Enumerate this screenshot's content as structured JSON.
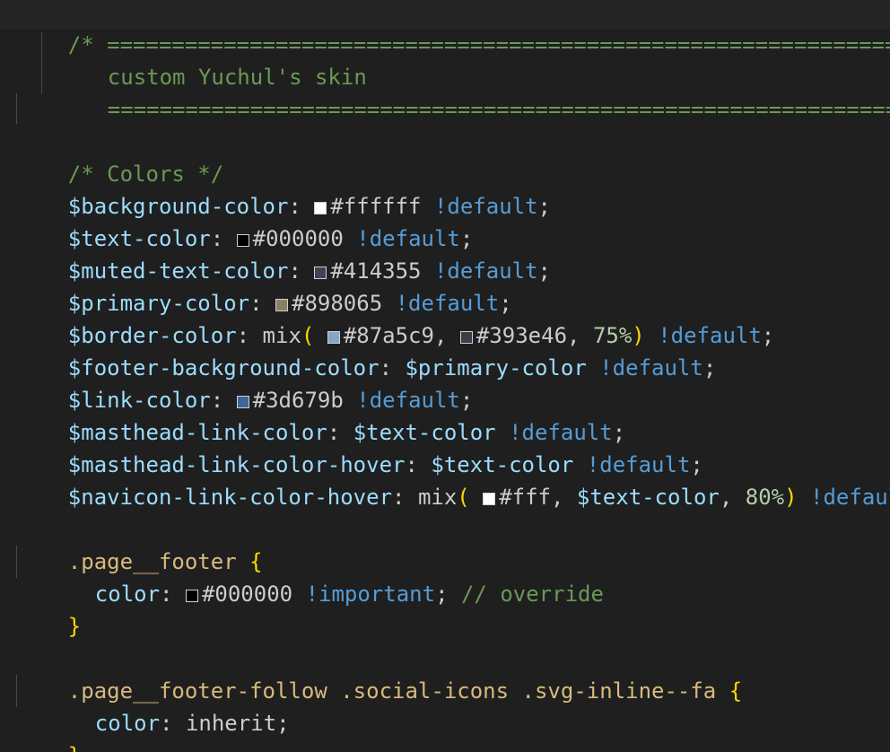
{
  "header_comment": {
    "open": "/* ",
    "rule": "================================================================",
    "title": "custom Yuchul's skin",
    "rule2": "================================================================"
  },
  "colors_comment": "/* Colors */",
  "default_kw": "!default",
  "important_kw": "!important",
  "swatch_colors": {
    "ffffff": "#ffffff",
    "000000": "#000000",
    "414355": "#414355",
    "898065": "#898065",
    "87a5c9": "#87a5c9",
    "393e46": "#393e46",
    "3d679b": "#3d679b",
    "fff": "#ffffff"
  },
  "vars": {
    "background": {
      "name": "$background-color",
      "value": "#ffffff"
    },
    "text": {
      "name": "$text-color",
      "value": "#000000"
    },
    "muted": {
      "name": "$muted-text-color",
      "value": "#414355"
    },
    "primary": {
      "name": "$primary-color",
      "value": "#898065"
    },
    "border": {
      "name": "$border-color",
      "fn": "mix",
      "arg1": "#87a5c9",
      "arg2": "#393e46",
      "pct": "75%"
    },
    "footer_bg": {
      "name": "$footer-background-color",
      "value": "$primary-color"
    },
    "link": {
      "name": "$link-color",
      "value": "#3d679b"
    },
    "masthead_link": {
      "name": "$masthead-link-color",
      "value": "$text-color"
    },
    "masthead_hover": {
      "name": "$masthead-link-color-hover",
      "value": "$text-color"
    },
    "navicon_hover": {
      "name": "$navicon-link-color-hover",
      "fn": "mix",
      "arg1": "#fff",
      "arg2": "$text-color",
      "pct": "80%"
    }
  },
  "footer_rule": {
    "selector": ".page__footer",
    "prop": "color",
    "value": "#000000",
    "comment": "// override"
  },
  "follow_rule": {
    "selector": ".page__footer-follow .social-icons .svg-inline--fa",
    "prop": "color",
    "value": "inherit"
  }
}
